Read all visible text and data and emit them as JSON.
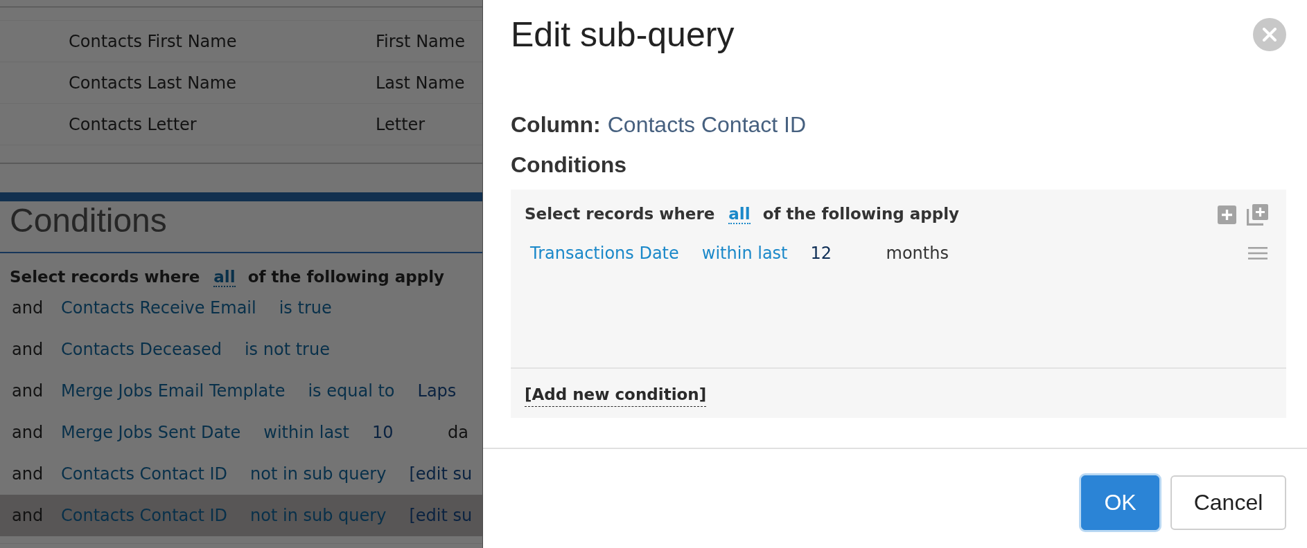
{
  "page": {
    "fields_table": {
      "rows": [
        {
          "column_1": "Contacts First Name",
          "column_2": "First Name"
        },
        {
          "column_1": "Contacts Last Name",
          "column_2": "Last Name"
        },
        {
          "column_1": "Contacts Letter",
          "column_2": "Letter"
        }
      ]
    },
    "conditions": {
      "title": "Conditions",
      "intro": {
        "before": "Select records where",
        "mode": "all",
        "after": "of the following apply"
      },
      "rows": [
        {
          "conjunction": "and",
          "field": "Contacts Receive Email",
          "operator": "is true",
          "selected": false
        },
        {
          "conjunction": "and",
          "field": "Contacts Deceased",
          "operator": "is not true",
          "selected": false
        },
        {
          "conjunction": "and",
          "field": "Merge Jobs Email Template",
          "operator": "is equal to",
          "value": "Laps",
          "selected": false
        },
        {
          "conjunction": "and",
          "field": "Merge Jobs Sent Date",
          "operator": "within last",
          "value": "10",
          "unit": "da",
          "selected": false
        },
        {
          "conjunction": "and",
          "field": "Contacts Contact ID",
          "operator": "not in sub query",
          "link": "[edit su",
          "selected": false
        },
        {
          "conjunction": "and",
          "field": "Contacts Contact ID",
          "operator": "not in sub query",
          "link": "[edit su",
          "selected": true
        }
      ]
    }
  },
  "dialog": {
    "title": "Edit sub-query",
    "column": {
      "label": "Column:",
      "value": "Contacts Contact ID"
    },
    "conditions_label": "Conditions",
    "group": {
      "intro": {
        "before": "Select records where",
        "mode": "all",
        "after": "of the following apply"
      },
      "conditions": [
        {
          "field": "Transactions Date",
          "operator": "within last",
          "value": "12",
          "unit": "months"
        }
      ],
      "add_link": "[Add new condition]"
    },
    "buttons": [
      {
        "label": "OK",
        "kind": "primary"
      },
      {
        "label": "Cancel",
        "kind": "secondary"
      }
    ]
  }
}
